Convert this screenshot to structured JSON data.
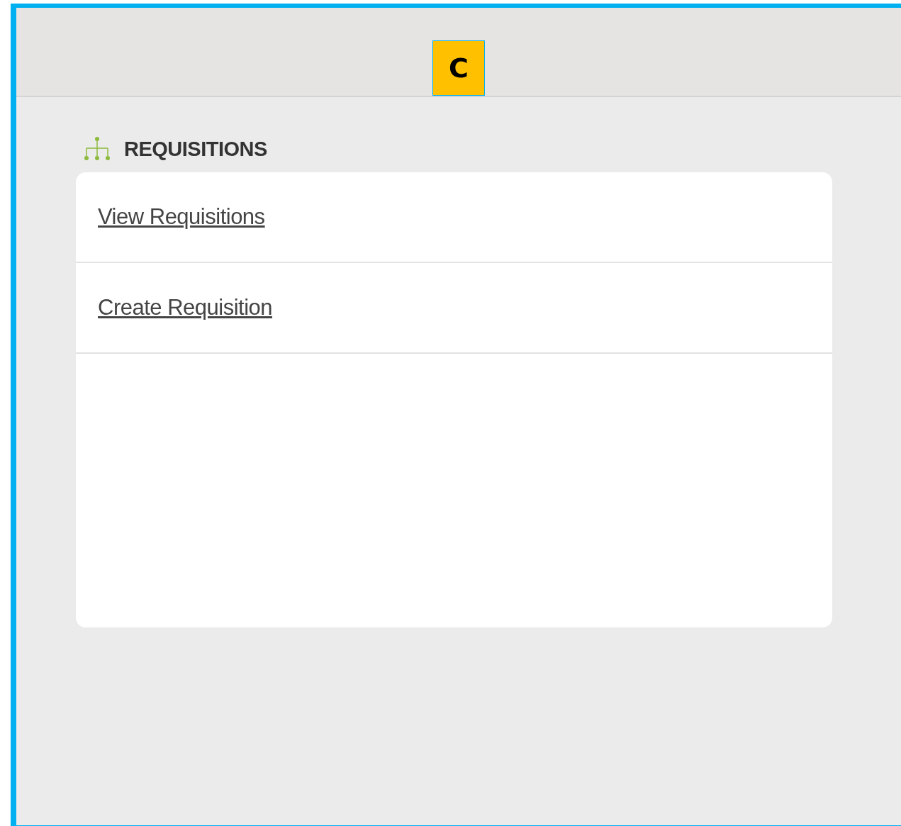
{
  "marker": {
    "label": "C"
  },
  "section": {
    "title": "REQUISITIONS"
  },
  "links": [
    {
      "label": "View Requisitions"
    },
    {
      "label": "Create Requisition"
    }
  ]
}
